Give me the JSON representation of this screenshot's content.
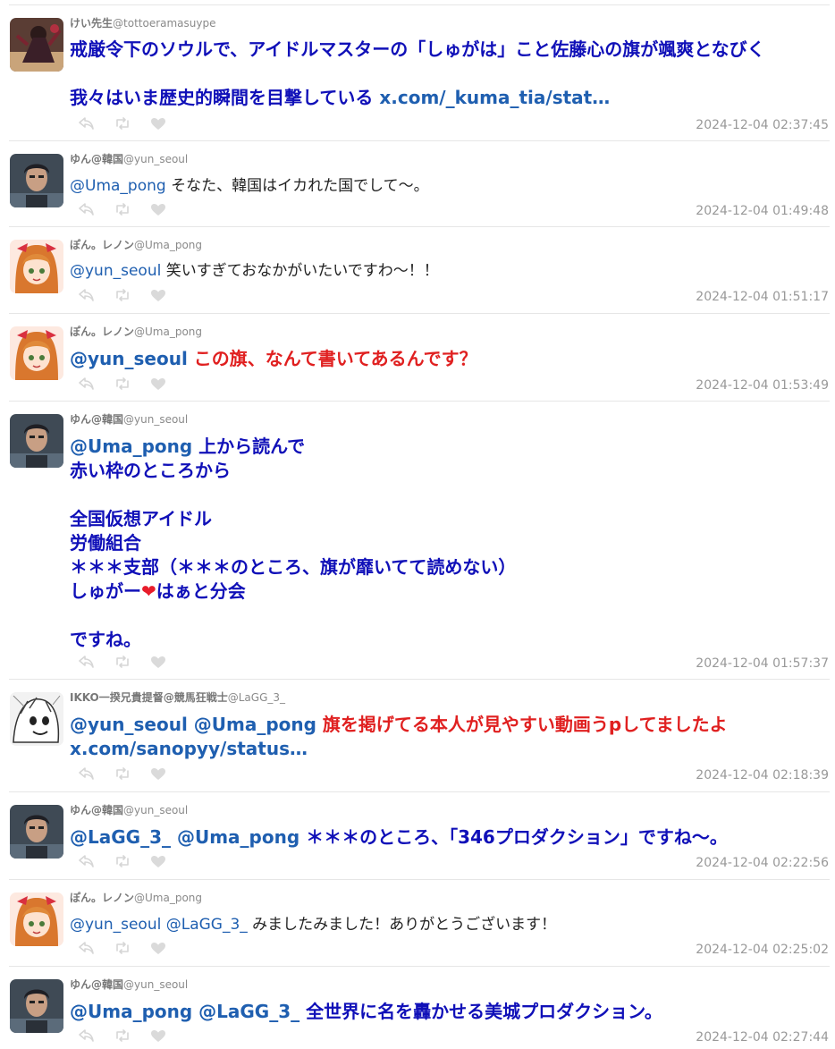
{
  "tweets": [
    {
      "display_name": "けい先生",
      "handle": "@tottoeramasuype",
      "style": "big",
      "segments": [
        {
          "t": "戒厳令下のソウルで、アイドルマスターの「しゅがは」こと佐藤心の旗が颯爽となびく\n\n我々はいま歴史的瞬間を目撃している ",
          "c": "c-blue"
        },
        {
          "t": "x.com/_kuma_tia/stat…",
          "c": "link"
        }
      ],
      "timestamp": "2024-12-04 02:37:45",
      "avatar": "dark-figure"
    },
    {
      "display_name": "ゆん@韓国",
      "handle": "@yun_seoul",
      "style": "plain",
      "segments": [
        {
          "t": "@Uma_pong",
          "c": "mention"
        },
        {
          "t": " そなた、韓国はイカれた国でして〜。",
          "c": ""
        }
      ],
      "timestamp": "2024-12-04 01:49:48",
      "avatar": "man"
    },
    {
      "display_name": "ぽん。レノン",
      "handle": "@Uma_pong",
      "style": "plain",
      "segments": [
        {
          "t": "@yun_seoul",
          "c": "mention"
        },
        {
          "t": " 笑いすぎておなかがいたいですわ〜！！",
          "c": ""
        }
      ],
      "timestamp": "2024-12-04 01:51:17",
      "avatar": "girl"
    },
    {
      "display_name": "ぽん。レノン",
      "handle": "@Uma_pong",
      "style": "big",
      "segments": [
        {
          "t": "@yun_seoul",
          "c": "mention"
        },
        {
          "t": " この旗、なんて書いてあるんです？",
          "c": "c-red"
        }
      ],
      "timestamp": "2024-12-04 01:53:49",
      "avatar": "girl"
    },
    {
      "display_name": "ゆん@韓国",
      "handle": "@yun_seoul",
      "style": "big",
      "segments": [
        {
          "t": "@Uma_pong",
          "c": "mention"
        },
        {
          "t": " 上から読んで\n赤い枠のところから\n\n全国仮想アイドル\n労働組合\n＊＊＊支部（＊＊＊のところ、旗が靡いてて読めない）\nしゅがー",
          "c": "c-blue"
        },
        {
          "t": "❤",
          "c": "heart-red"
        },
        {
          "t": "はぁと分会\n\nですね。",
          "c": "c-blue"
        }
      ],
      "timestamp": "2024-12-04 01:57:37",
      "avatar": "man"
    },
    {
      "display_name": "IKKO一揆兄貴提督@競馬狂戦士",
      "handle": "@LaGG_3_",
      "style": "big",
      "segments": [
        {
          "t": "@yun_seoul @Uma_pong",
          "c": "mention"
        },
        {
          "t": " 旗を掲げてる本人が見やすい動画うpしてましたよ\n",
          "c": "c-red"
        },
        {
          "t": "x.com/sanopyy/status…",
          "c": "link"
        }
      ],
      "timestamp": "2024-12-04 02:18:39",
      "avatar": "manga"
    },
    {
      "display_name": "ゆん@韓国",
      "handle": "@yun_seoul",
      "style": "big",
      "segments": [
        {
          "t": "@LaGG_3_ @Uma_pong",
          "c": "mention"
        },
        {
          "t": " ＊＊＊のところ、「346プロダクション」ですね〜。",
          "c": "c-blue"
        }
      ],
      "timestamp": "2024-12-04 02:22:56",
      "avatar": "man"
    },
    {
      "display_name": "ぽん。レノン",
      "handle": "@Uma_pong",
      "style": "plain",
      "segments": [
        {
          "t": "@yun_seoul @LaGG_3_",
          "c": "mention"
        },
        {
          "t": " みましたみました！ありがとうございます！",
          "c": ""
        }
      ],
      "timestamp": "2024-12-04 02:25:02",
      "avatar": "girl"
    },
    {
      "display_name": "ゆん@韓国",
      "handle": "@yun_seoul",
      "style": "big",
      "segments": [
        {
          "t": "@Uma_pong @LaGG_3_",
          "c": "mention"
        },
        {
          "t": " 全世界に名を轟かせる美城プロダクション。",
          "c": "c-blue"
        }
      ],
      "timestamp": "2024-12-04 02:27:44",
      "avatar": "man"
    }
  ]
}
